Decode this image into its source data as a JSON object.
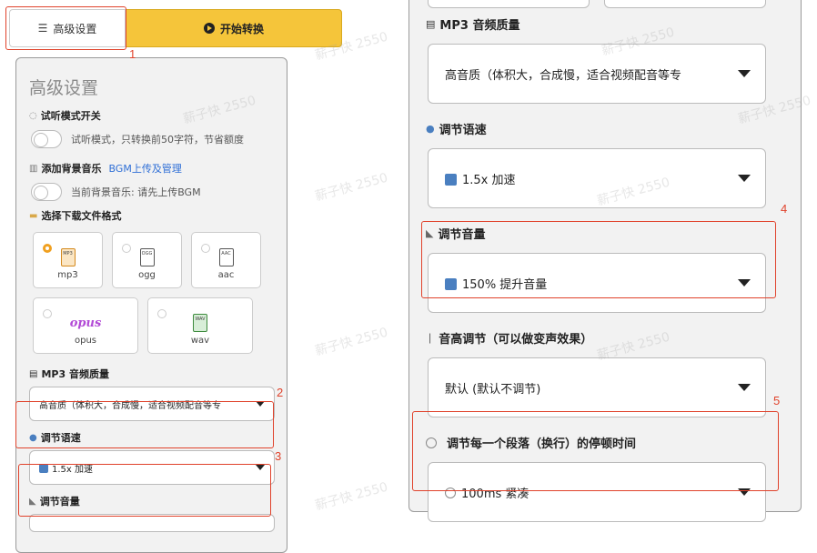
{
  "left": {
    "tabs": {
      "advanced": "高级设置",
      "start": "开始转换"
    },
    "panel_title": "高级设置",
    "preview_mode": {
      "label": "试听模式开关",
      "text": "试听模式，只转换前50字符，节省额度"
    },
    "bgm": {
      "label": "添加背景音乐",
      "link": "BGM上传及管理",
      "text": "当前背景音乐: 请先上传BGM"
    },
    "format": {
      "label": "选择下载文件格式",
      "options": [
        {
          "name": "mp3",
          "icon_text": "MP3",
          "selected": true
        },
        {
          "name": "ogg",
          "icon_text": "OGG",
          "selected": false
        },
        {
          "name": "aac",
          "icon_text": "AAC",
          "selected": false
        },
        {
          "name": "opus",
          "icon_text": "opus",
          "selected": false
        },
        {
          "name": "wav",
          "icon_text": "WAV",
          "selected": false
        }
      ]
    },
    "quality": {
      "label": "MP3 音频质量",
      "value": "高音质（体积大，合成慢，适合视频配音等专"
    },
    "speed": {
      "label": "调节语速",
      "value": "1.5x 加速"
    },
    "volume": {
      "label": "调节音量"
    }
  },
  "right": {
    "quality": {
      "label": "MP3 音频质量",
      "value": "高音质（体积大，合成慢，适合视频配音等专"
    },
    "speed": {
      "label": "调节语速",
      "value": "1.5x 加速"
    },
    "volume": {
      "label": "调节音量",
      "value": "150% 提升音量"
    },
    "pitch": {
      "label": "音高调节（可以做变声效果）",
      "value": "默认 (默认不调节)"
    },
    "pause": {
      "label": "调节每一个段落（换行）的停顿时间",
      "value": "100ms 紧凑"
    }
  },
  "annotations": [
    "1",
    "2",
    "3",
    "4",
    "5"
  ],
  "watermark": "薪子快 2550",
  "colors": {
    "accent_yellow": "#f5c53a",
    "annotation_red": "#e0422b",
    "link_blue": "#2f6fd6"
  }
}
